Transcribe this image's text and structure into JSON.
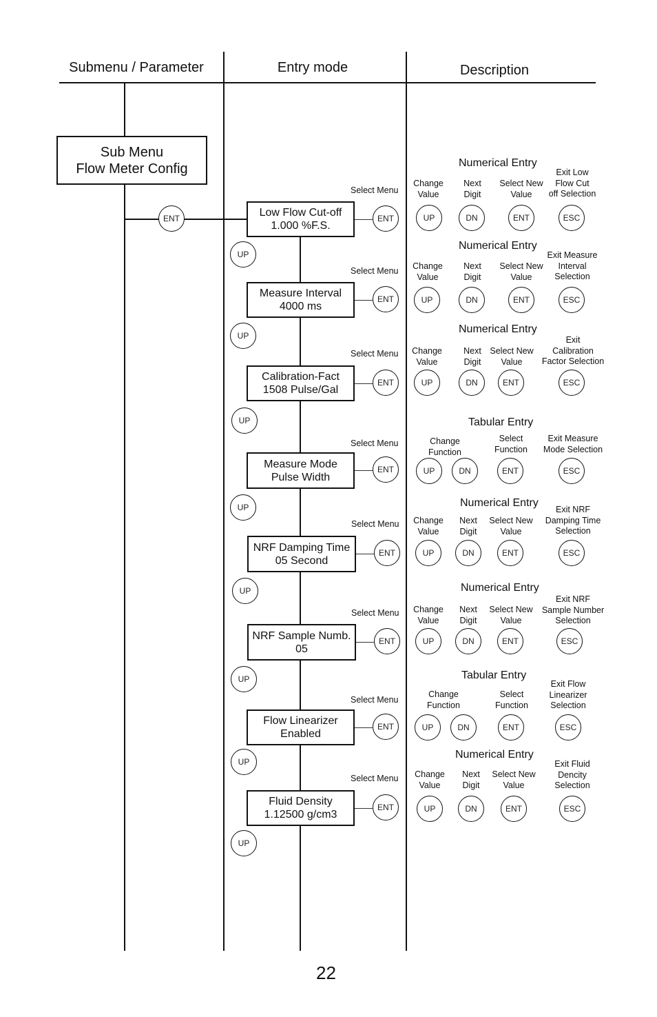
{
  "headers": {
    "col1": "Submenu / Parameter",
    "col2": "Entry mode",
    "col3": "Description"
  },
  "submenu": {
    "line1": "Sub Menu",
    "line2": "Flow Meter Config"
  },
  "entry_button": "ENT",
  "select_menu_label": "Select Menu",
  "up_label": "UP",
  "ent_label": "ENT",
  "parameters": [
    {
      "line1": "Low Flow Cut-off",
      "line2": "1.000 %F.S."
    },
    {
      "line1": "Measure Interval",
      "line2": "4000 ms"
    },
    {
      "line1": "Calibration-Fact",
      "line2": "1508 Pulse/Gal"
    },
    {
      "line1": "Measure Mode",
      "line2": "Pulse Width"
    },
    {
      "line1": "NRF Damping Time",
      "line2": "05 Second"
    },
    {
      "line1": "NRF Sample Numb.",
      "line2": "05"
    },
    {
      "line1": "Flow Linearizer",
      "line2": "Enabled"
    },
    {
      "line1": "Fluid Density",
      "line2": "1.12500 g/cm3"
    }
  ],
  "descriptions": [
    {
      "mode": "Numerical Entry",
      "labels": [
        "Change\nValue",
        "Next\nDigit",
        "Select New\nValue",
        "Exit Low\nFlow Cut\noff Selection"
      ],
      "buttons": [
        "UP",
        "DN",
        "ENT",
        "ESC"
      ]
    },
    {
      "mode": "Numerical Entry",
      "labels": [
        "Change\nValue",
        "Next\nDigit",
        "Select New\nValue",
        "Exit Measure\nInterval\nSelection"
      ],
      "buttons": [
        "UP",
        "DN",
        "ENT",
        "ESC"
      ]
    },
    {
      "mode": "Numerical Entry",
      "labels": [
        "Change\nValue",
        "Next\nDigit",
        "Select New\nValue",
        "Exit\nCalibration\nFactor Selection"
      ],
      "buttons": [
        "UP",
        "DN",
        "ENT",
        "ESC"
      ]
    },
    {
      "mode": "Tabular Entry",
      "labels": [
        "Change\nFunction",
        "Select\nFunction",
        "Exit Measure\nMode Selection"
      ],
      "buttons": [
        "UP",
        "DN",
        "ENT",
        "ESC"
      ]
    },
    {
      "mode": "Numerical Entry",
      "labels": [
        "Change\nValue",
        "Next\nDigit",
        "Select New\nValue",
        "Exit NRF\nDamping Time\nSelection"
      ],
      "buttons": [
        "UP",
        "DN",
        "ENT",
        "ESC"
      ]
    },
    {
      "mode": "Numerical Entry",
      "labels": [
        "Change\nValue",
        "Next\nDigit",
        "Select New\nValue",
        "Exit NRF\nSample Number\nSelection"
      ],
      "buttons": [
        "UP",
        "DN",
        "ENT",
        "ESC"
      ]
    },
    {
      "mode": "Tabular Entry",
      "labels": [
        "Change\nFunction",
        "Select\nFunction",
        "Exit Flow\nLinearizer\nSelection"
      ],
      "buttons": [
        "UP",
        "DN",
        "ENT",
        "ESC"
      ]
    },
    {
      "mode": "Numerical Entry",
      "labels": [
        "Change\nValue",
        "Next\nDigit",
        "Select New\nValue",
        "Exit Fluid\nDencity\nSelection"
      ],
      "buttons": [
        "UP",
        "DN",
        "ENT",
        "ESC"
      ]
    }
  ],
  "page_number": "22"
}
